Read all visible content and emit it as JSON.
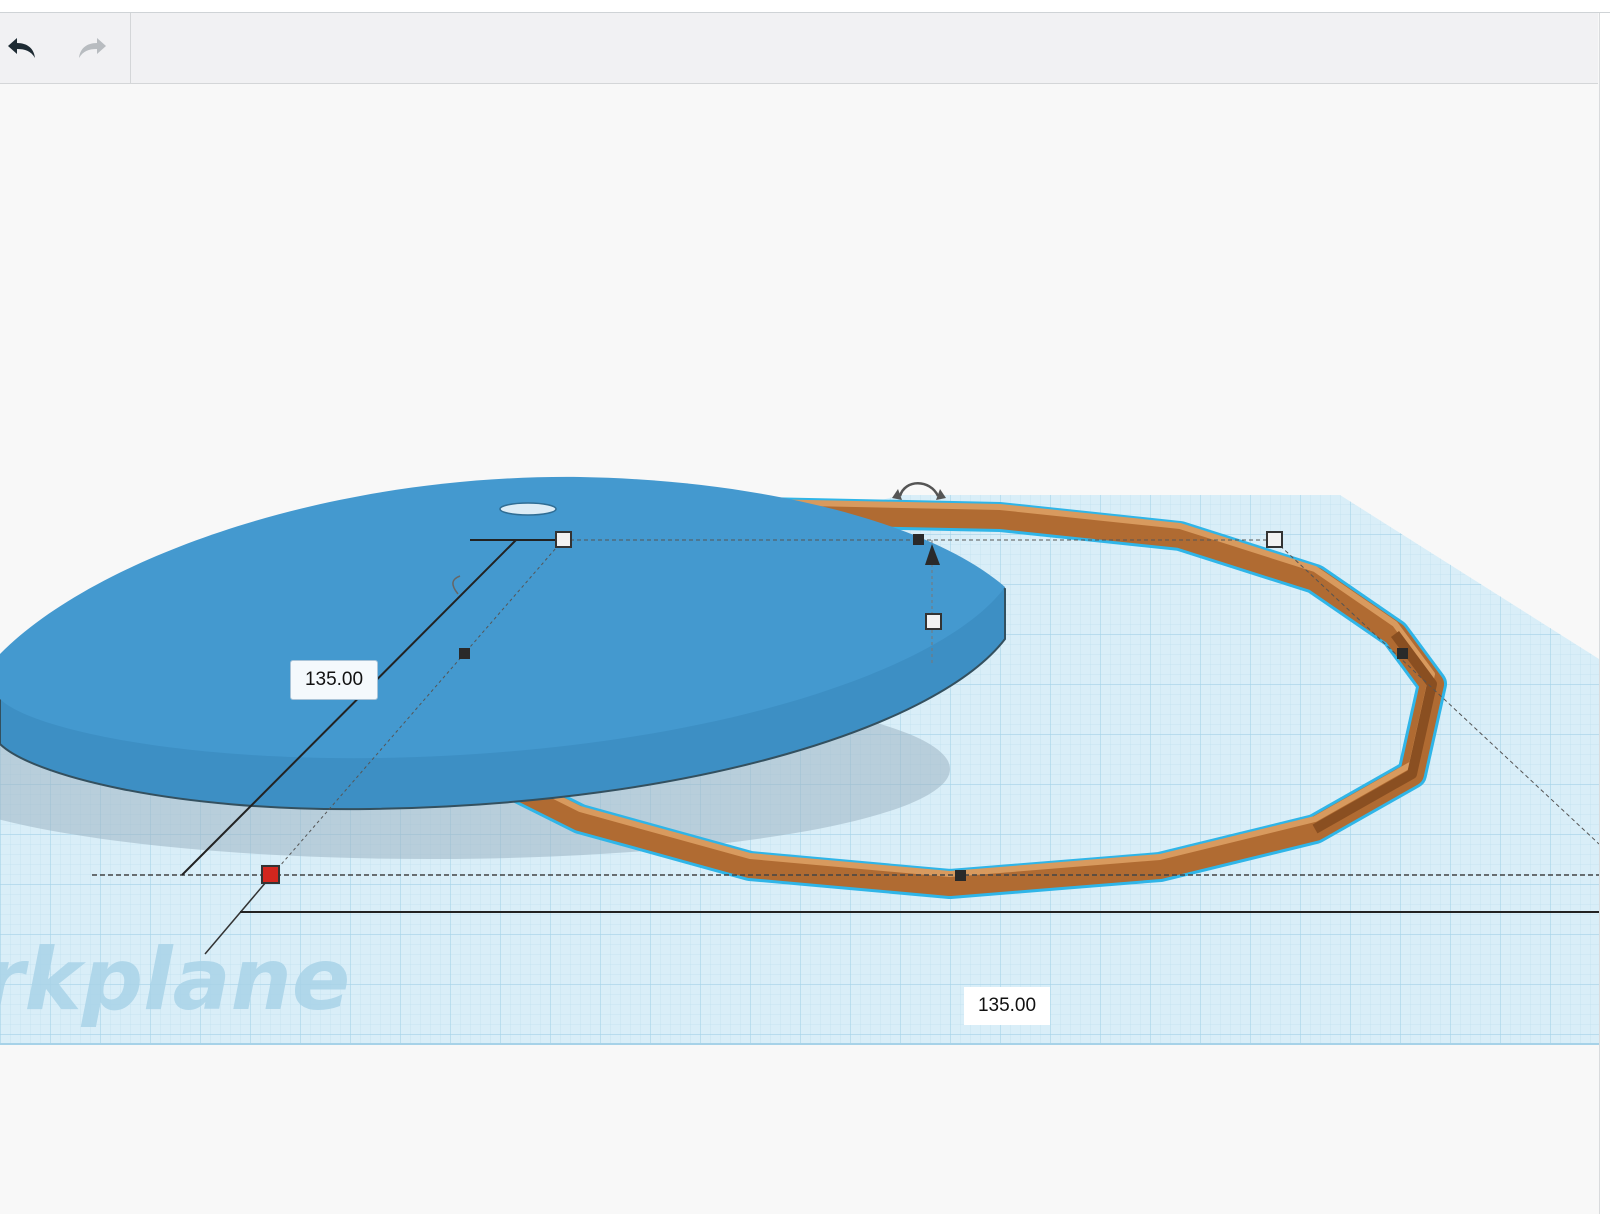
{
  "toolbar": {
    "undo_icon": "undo-arrow-icon",
    "redo_icon": "redo-arrow-icon"
  },
  "workplane": {
    "watermark": "rkplane",
    "colors": {
      "grid": "#cde7f3",
      "plane": "#d9eef8",
      "disc": "#4499cf",
      "ring": "#c27c3e",
      "selection": "#2fb5e8",
      "handle_active": "#d3261e"
    }
  },
  "dimensions": {
    "left_value": "135.00",
    "bottom_value": "135.00"
  }
}
